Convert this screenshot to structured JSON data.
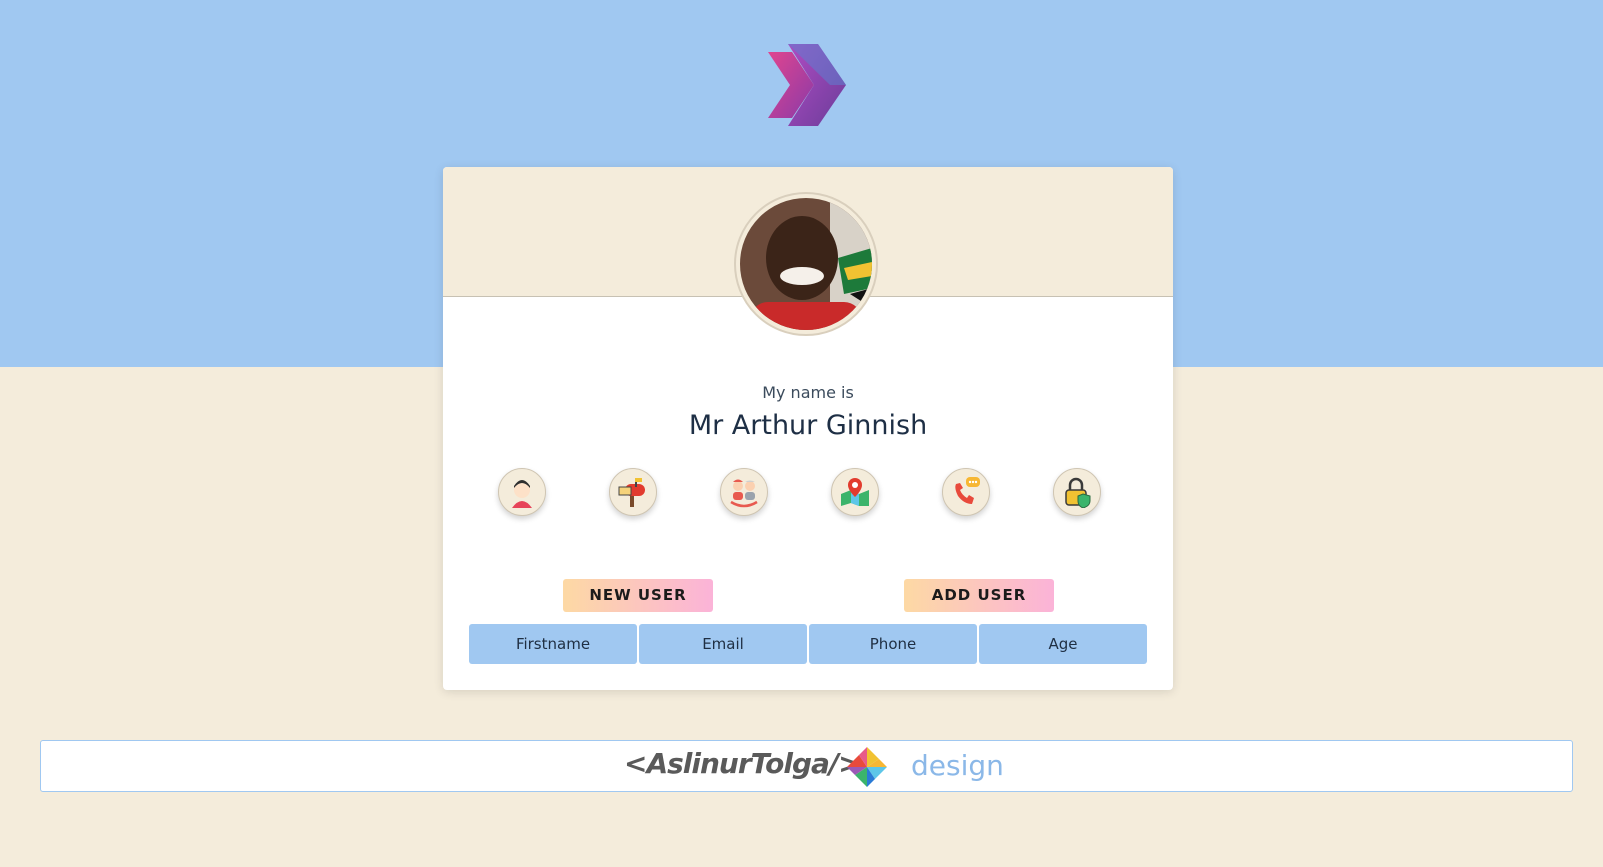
{
  "colors": {
    "top_band": "#a0c8f1",
    "page_bg": "#f4ecdb",
    "card_bg": "#ffffff",
    "tab_bg": "#a0c8f1",
    "pill_gradient_start": "#fdd9a4",
    "pill_gradient_end": "#fbb3d8",
    "footer_accent": "#8bb8e8"
  },
  "logo": {
    "icon": "double-chevron-logo-icon"
  },
  "profile": {
    "label": "My name is",
    "value": "Mr Arthur Ginnish",
    "avatar_icon": "user-photo-avatar"
  },
  "info_icons": [
    {
      "name": "user-icon"
    },
    {
      "name": "mailbox-icon"
    },
    {
      "name": "people-age-icon"
    },
    {
      "name": "map-location-icon"
    },
    {
      "name": "phone-icon"
    },
    {
      "name": "lock-password-icon"
    }
  ],
  "actions": {
    "new_user": "NEW USER",
    "add_user": "ADD USER"
  },
  "tabs": [
    "Firstname",
    "Email",
    "Phone",
    "Age"
  ],
  "footer": {
    "brand": "<AslinurTolga/>",
    "design": "design",
    "logo_icon": "pinwheel-icon"
  }
}
